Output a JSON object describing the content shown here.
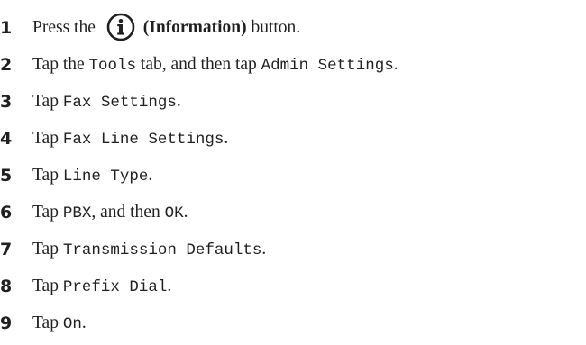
{
  "steps": [
    {
      "number": "1",
      "pre": "Press the ",
      "icon": "information-icon",
      "bold": "(Information)",
      "post": " button."
    },
    {
      "number": "2",
      "pre": "Tap the ",
      "code1": "Tools",
      "mid": " tab, and then tap ",
      "code2": "Admin Settings",
      "post": "."
    },
    {
      "number": "3",
      "pre": "Tap ",
      "code": "Fax Settings",
      "post": "."
    },
    {
      "number": "4",
      "pre": "Tap ",
      "code": "Fax Line Settings",
      "post": "."
    },
    {
      "number": "5",
      "pre": "Tap ",
      "code": "Line Type",
      "post": "."
    },
    {
      "number": "6",
      "pre": "Tap ",
      "code1": "PBX",
      "mid": ", and then ",
      "code2": "OK",
      "post": "."
    },
    {
      "number": "7",
      "pre": "Tap ",
      "code": "Transmission Defaults",
      "post": "."
    },
    {
      "number": "8",
      "pre": "Tap ",
      "code": "Prefix Dial",
      "post": "."
    },
    {
      "number": "9",
      "pre": "Tap ",
      "code": "On",
      "post": "."
    }
  ]
}
